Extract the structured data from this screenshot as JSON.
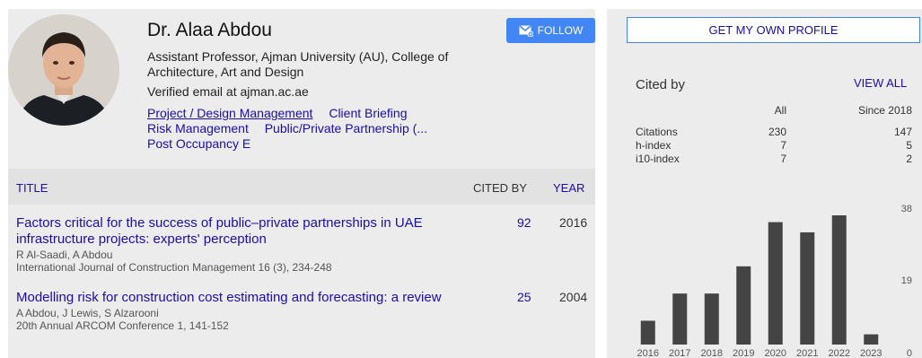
{
  "profile": {
    "name": "Dr. Alaa Abdou",
    "affiliation": "Assistant Professor, Ajman University (AU), College of Architecture, Art and Design",
    "verified": "Verified email at ajman.ac.ae",
    "interests": [
      "Project / Design Management",
      "Client Briefing",
      "Risk Management",
      "Public/Private Partnership (...",
      "Post Occupancy E"
    ],
    "follow_label": "FOLLOW"
  },
  "table": {
    "col_title": "TITLE",
    "col_cited": "CITED BY",
    "col_year": "YEAR",
    "rows": [
      {
        "title": "Factors critical for the success of public–private partnerships in UAE infrastructure projects: experts' perception",
        "authors": "R Al-Saadi, A Abdou",
        "venue": "International Journal of Construction Management 16 (3), 234-248",
        "cited": "92",
        "year": "2016"
      },
      {
        "title": "Modelling risk for construction cost estimating and forecasting: a review",
        "authors": "A Abdou, J Lewis, S Alzarooni",
        "venue": "20th Annual ARCOM Conference 1, 141-152",
        "cited": "25",
        "year": "2004"
      }
    ]
  },
  "sidebar": {
    "own_profile_label": "GET MY OWN PROFILE",
    "cited_by": "Cited by",
    "view_all": "VIEW ALL",
    "col_all": "All",
    "col_since": "Since 2018",
    "stats": [
      {
        "label": "Citations",
        "all": "230",
        "since": "147"
      },
      {
        "label": "h-index",
        "all": "7",
        "since": "5"
      },
      {
        "label": "i10-index",
        "all": "7",
        "since": "2"
      }
    ]
  },
  "chart_data": {
    "type": "bar",
    "categories": [
      "2016",
      "2017",
      "2018",
      "2019",
      "2020",
      "2021",
      "2022",
      "2023"
    ],
    "values": [
      7,
      15,
      15,
      23,
      36,
      33,
      38,
      3
    ],
    "ylim": [
      0,
      38
    ],
    "yticks": [
      "38",
      "19",
      "0"
    ],
    "bar_color": "#444444"
  }
}
